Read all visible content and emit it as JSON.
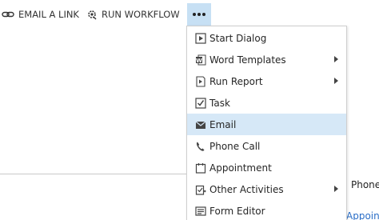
{
  "toolbar": {
    "email_link_label": "EMAIL A LINK",
    "run_workflow_label": "RUN WORKFLOW",
    "more_icon": "ellipsis-icon"
  },
  "background": {
    "phone_fragment": "Phone",
    "appointment_fragment": "Appoin"
  },
  "menu": {
    "items": [
      {
        "label": "Start Dialog",
        "icon": "start-dialog-icon",
        "submenu": false,
        "selected": false
      },
      {
        "label": "Word Templates",
        "icon": "word-icon",
        "submenu": true,
        "selected": false
      },
      {
        "label": "Run Report",
        "icon": "report-icon",
        "submenu": true,
        "selected": false
      },
      {
        "label": "Task",
        "icon": "task-checkbox-icon",
        "submenu": false,
        "selected": false
      },
      {
        "label": "Email",
        "icon": "envelope-icon",
        "submenu": false,
        "selected": true
      },
      {
        "label": "Phone Call",
        "icon": "phone-icon",
        "submenu": false,
        "selected": false
      },
      {
        "label": "Appointment",
        "icon": "appointment-icon",
        "submenu": false,
        "selected": false
      },
      {
        "label": "Other Activities",
        "icon": "other-activities-icon",
        "submenu": true,
        "selected": false
      },
      {
        "label": "Form Editor",
        "icon": "form-editor-icon",
        "submenu": false,
        "selected": false
      }
    ]
  },
  "colors": {
    "highlight": "#d6e8f7",
    "more_button_bg": "#c7e0f4",
    "link_blue": "#2b6ec7"
  }
}
